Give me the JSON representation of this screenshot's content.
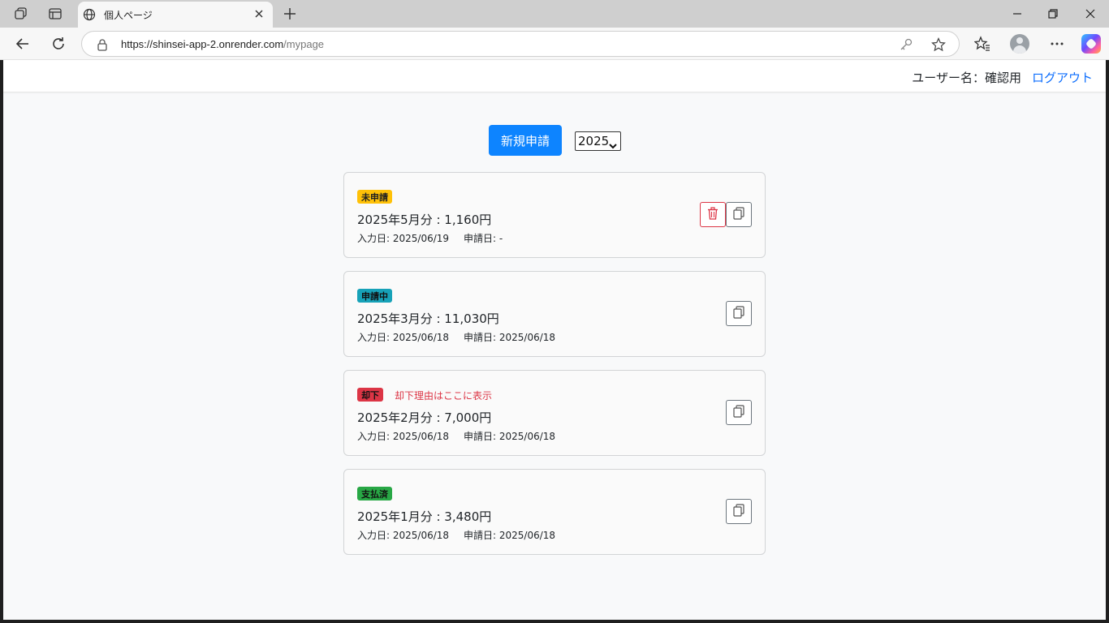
{
  "browser": {
    "tab_title": "個人ページ",
    "url_host": "https://shinsei-app-2.onrender.com",
    "url_path": "/mypage"
  },
  "header": {
    "user_label": "ユーザー名：確認用",
    "logout_label": "ログアウト"
  },
  "controls": {
    "new_button_label": "新規申請",
    "year_selected": "2025"
  },
  "applications": [
    {
      "status": "未申請",
      "status_color": "#ffc107",
      "reason": "",
      "amount": "2025年5月分 : 1,160円",
      "input_date": "入力日: 2025/06/19",
      "apply_date": "申請日: -",
      "deletable": true
    },
    {
      "status": "申請中",
      "status_color": "#17a2b8",
      "reason": "",
      "amount": "2025年3月分 : 11,030円",
      "input_date": "入力日: 2025/06/18",
      "apply_date": "申請日: 2025/06/18",
      "deletable": false
    },
    {
      "status": "却下",
      "status_color": "#dc3545",
      "reason": "却下理由はここに表示",
      "amount": "2025年2月分 : 7,000円",
      "input_date": "入力日: 2025/06/18",
      "apply_date": "申請日: 2025/06/18",
      "deletable": false
    },
    {
      "status": "支払済",
      "status_color": "#28a745",
      "reason": "",
      "amount": "2025年1月分 : 3,480円",
      "input_date": "入力日: 2025/06/18",
      "apply_date": "申請日: 2025/06/18",
      "deletable": false
    }
  ],
  "icons": {
    "delete": "trash-icon",
    "copy": "copy-icon"
  }
}
